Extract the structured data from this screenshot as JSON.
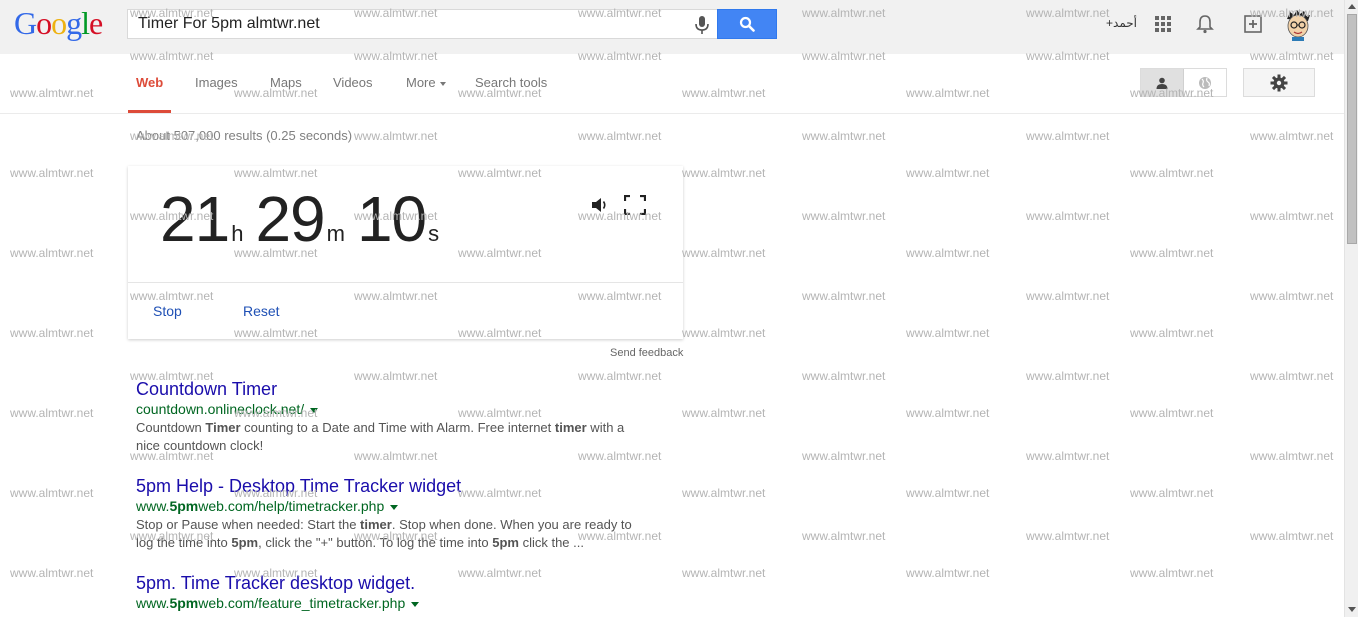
{
  "header": {
    "logo_letters": [
      {
        "char": "G",
        "color": "#3369e8"
      },
      {
        "char": "o",
        "color": "#d50f25"
      },
      {
        "char": "o",
        "color": "#eeb211"
      },
      {
        "char": "g",
        "color": "#3369e8"
      },
      {
        "char": "l",
        "color": "#009925"
      },
      {
        "char": "e",
        "color": "#d50f25"
      }
    ],
    "search_value": "Timer For 5pm almtwr.net",
    "user_name": "+أحمد",
    "icons": [
      "mic-icon",
      "search-icon",
      "apps-grid-icon",
      "notifications-bell-icon",
      "share-plus-icon",
      "avatar"
    ]
  },
  "nav": {
    "tabs": [
      {
        "label": "Web",
        "active": true
      },
      {
        "label": "Images",
        "active": false
      },
      {
        "label": "Maps",
        "active": false
      },
      {
        "label": "Videos",
        "active": false
      },
      {
        "label": "More",
        "active": false
      },
      {
        "label": "Search tools",
        "active": false
      }
    ],
    "toggle_icons": [
      "person-icon",
      "globe-icon"
    ],
    "settings_icon": "gear-icon"
  },
  "result_stats": "About 507,000 results (0.25 seconds)",
  "timer": {
    "hours": "21",
    "hours_unit": "h",
    "minutes": "29",
    "minutes_unit": "m",
    "seconds": "10",
    "seconds_unit": "s",
    "stop_label": "Stop",
    "reset_label": "Reset",
    "send_feedback": "Send feedback"
  },
  "results": [
    {
      "title": "Countdown Timer",
      "url": "countdown.onlineclock.net/",
      "snippet": [
        {
          "text": "Countdown ",
          "bold": false
        },
        {
          "text": "Timer",
          "bold": true
        },
        {
          "text": " counting to a Date and Time with Alarm. Free internet ",
          "bold": false
        },
        {
          "text": "timer",
          "bold": true
        },
        {
          "text": " with a nice countdown clock!",
          "bold": false
        }
      ]
    },
    {
      "title": "5pm Help - Desktop Time Tracker widget",
      "url_parts": [
        {
          "text": "www.",
          "bold": false
        },
        {
          "text": "5pm",
          "bold": true
        },
        {
          "text": "web.com/help/timetracker.php",
          "bold": false
        }
      ],
      "snippet": [
        {
          "text": "Stop or Pause when needed: Start the ",
          "bold": false
        },
        {
          "text": "timer",
          "bold": true
        },
        {
          "text": ". Stop when done. When you are ready to log the time into ",
          "bold": false
        },
        {
          "text": "5pm",
          "bold": true
        },
        {
          "text": ", click the \"+\" button. To log the time into ",
          "bold": false
        },
        {
          "text": "5pm",
          "bold": true
        },
        {
          "text": " click the ...",
          "bold": false
        }
      ]
    },
    {
      "title": "5pm. Time Tracker desktop widget.",
      "url_parts": [
        {
          "text": "www.",
          "bold": false
        },
        {
          "text": "5pm",
          "bold": true
        },
        {
          "text": "web.com/feature_timetracker.php",
          "bold": false
        }
      ]
    }
  ],
  "watermark_text": "www.almtwr.net"
}
